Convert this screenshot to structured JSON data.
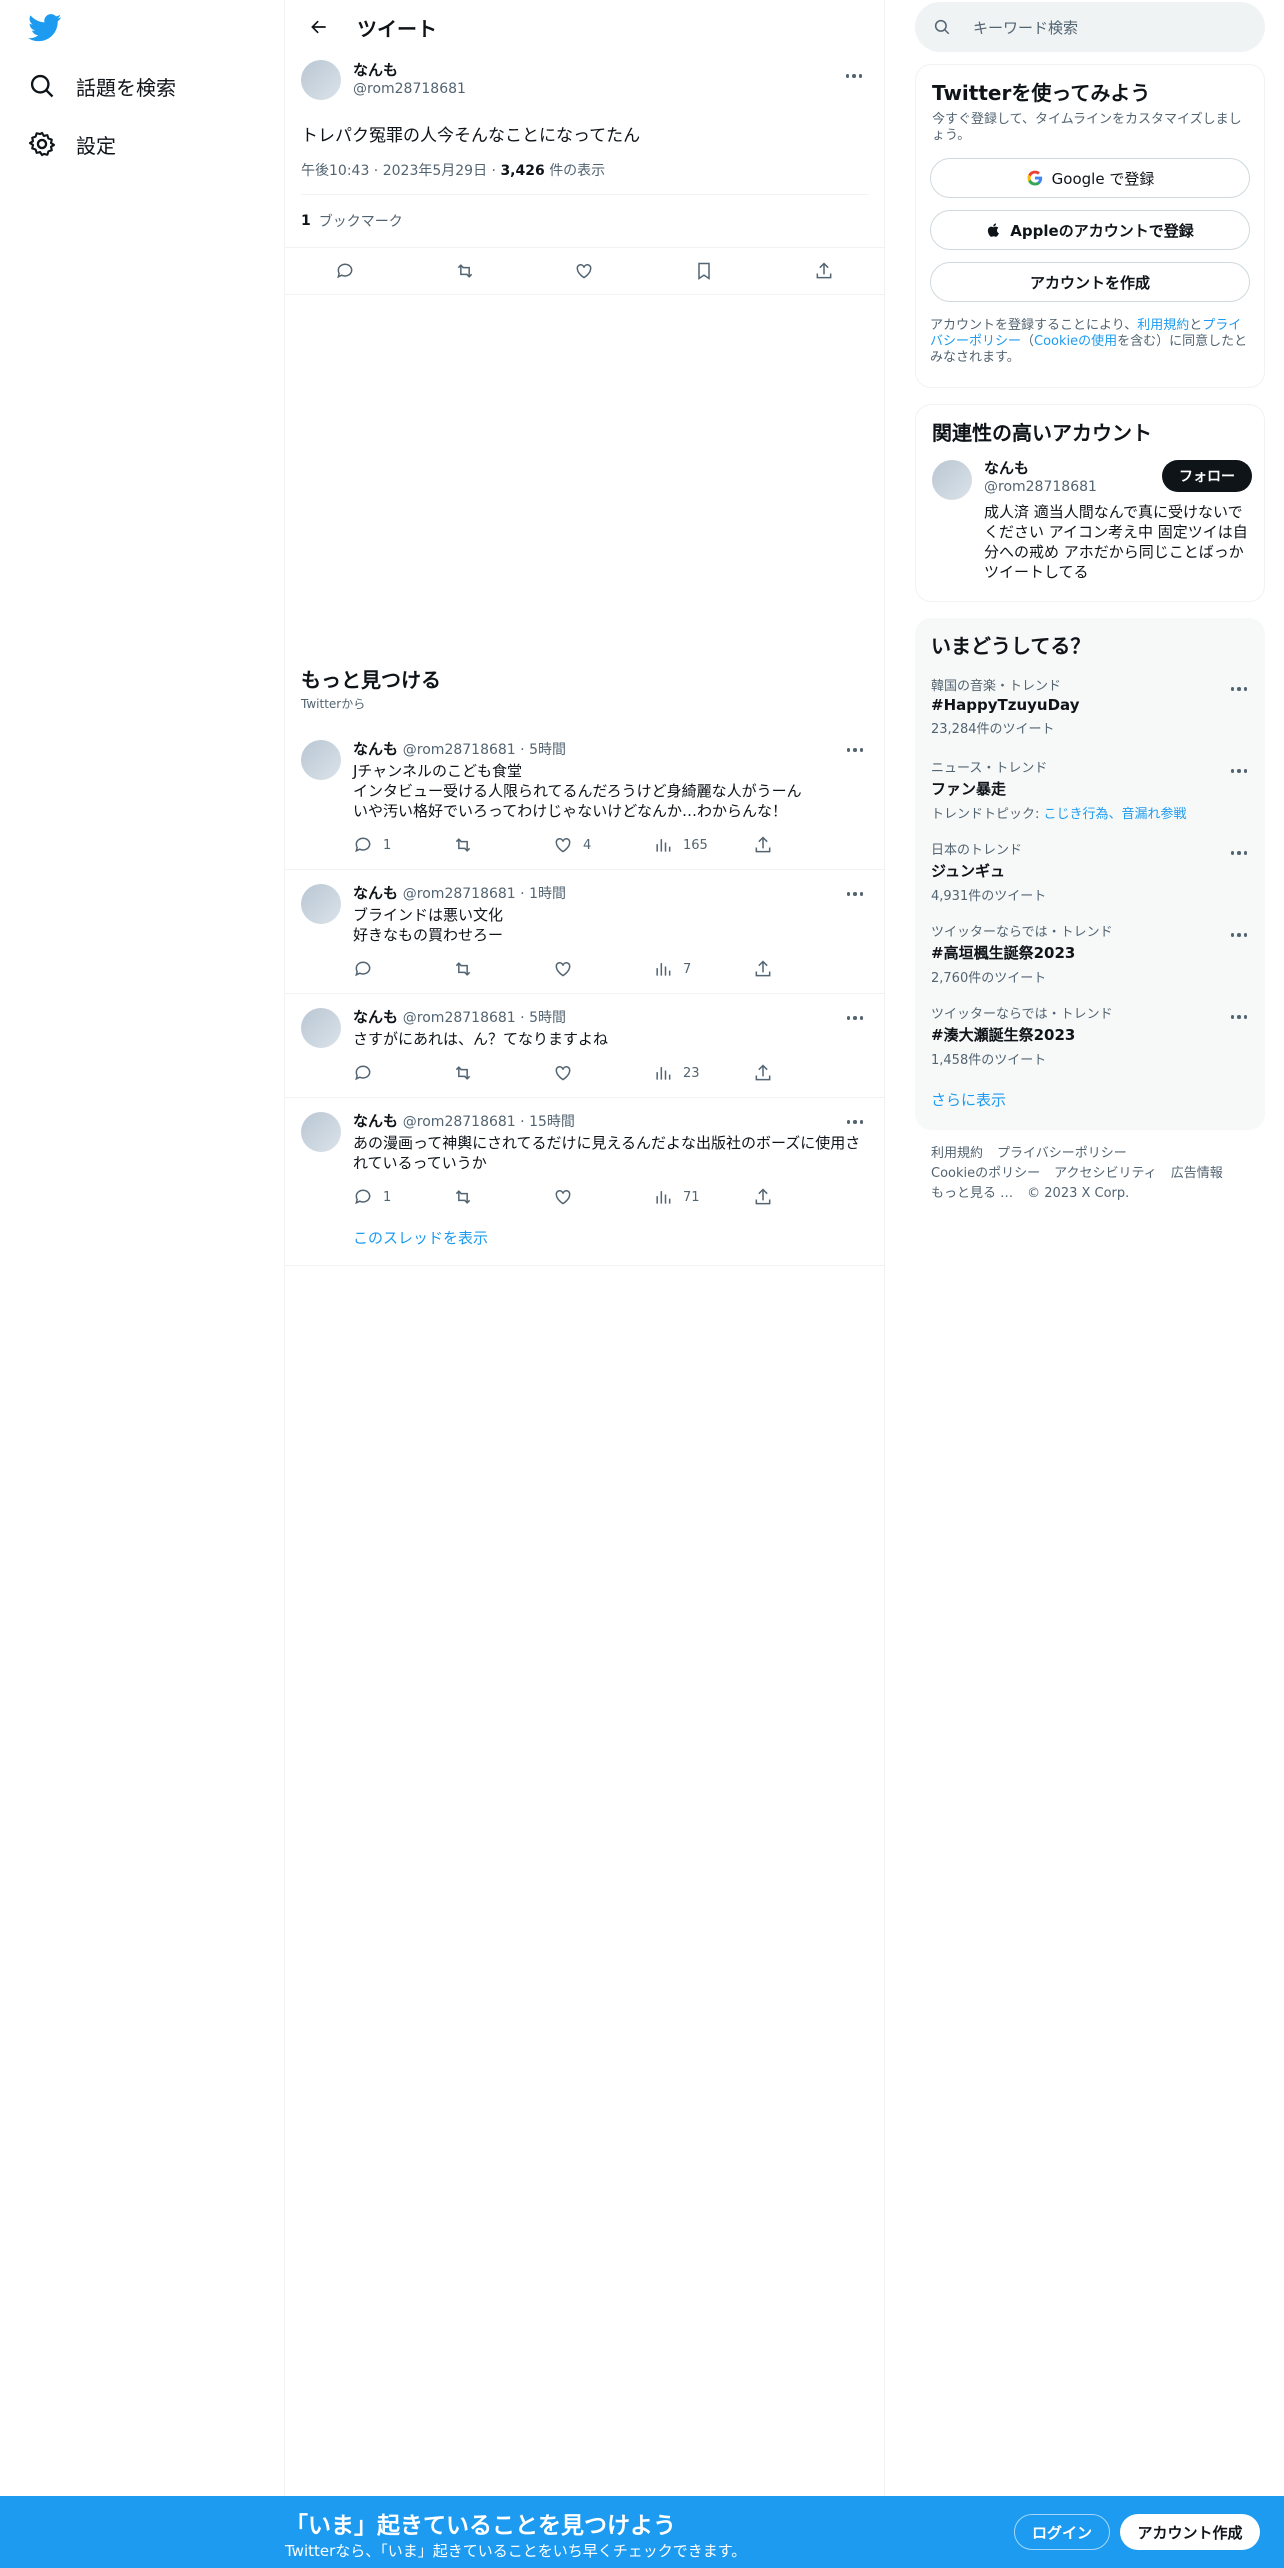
{
  "nav": {
    "search_label": "話題を検索",
    "settings_label": "設定"
  },
  "header": {
    "title": "ツイート"
  },
  "tweet": {
    "name": "なんも",
    "handle": "@rom28718681",
    "text": "トレパク冤罪の人今そんなことになってたん",
    "time": "午後10:43",
    "date": "2023年5月29日",
    "views": "3,426",
    "views_suffix": "件の表示",
    "bookmark_count": "1",
    "bookmark_label": "ブックマーク"
  },
  "discover": {
    "title": "もっと見つける",
    "subtitle": "Twitterから"
  },
  "replies": [
    {
      "name": "なんも",
      "handle": "@rom28718681",
      "time": "5時間",
      "line1": "Jチャンネルのこども食堂",
      "line2": "インタビュー受ける人限られてるんだろうけど身綺麗な人がうーん",
      "line3": "いや汚い格好でいろってわけじゃないけどなんか…わからんな！",
      "replies": "1",
      "retweets": "",
      "likes": "4",
      "views": "165"
    },
    {
      "name": "なんも",
      "handle": "@rom28718681",
      "time": "1時間",
      "line1": "ブラインドは悪い文化",
      "line2": "好きなもの買わせろー",
      "replies": "",
      "retweets": "",
      "likes": "",
      "views": "7"
    },
    {
      "name": "なんも",
      "handle": "@rom28718681",
      "time": "5時間",
      "line1": "さすがにあれは、ん？てなりますよね",
      "replies": "",
      "retweets": "",
      "likes": "",
      "views": "23"
    },
    {
      "name": "なんも",
      "handle": "@rom28718681",
      "time": "15時間",
      "line1": "あの漫画って神輿にされてるだけに見えるんだよな出版社のボーズに使用さ",
      "line2": "れているっていうか",
      "replies": "1",
      "retweets": "",
      "likes": "",
      "views": "71"
    }
  ],
  "show_thread": "このスレッドを表示",
  "search": {
    "placeholder": "キーワード検索"
  },
  "signup_card": {
    "title": "Twitterを使ってみよう",
    "subtitle": "今すぐ登録して、タイムラインをカスタマイズしましょう。",
    "google": "Google で登録",
    "apple": "Appleのアカウントで登録",
    "create": "アカウントを作成",
    "legal_1": "アカウントを登録することにより、",
    "legal_terms": "利用規約",
    "legal_2": "と",
    "legal_privacy": "プライバシーポリシー",
    "legal_3": "（",
    "legal_cookie": "Cookieの使用",
    "legal_4": "を含む）に同意したとみなされます。"
  },
  "related": {
    "title": "関連性の高いアカウント",
    "name": "なんも",
    "handle": "@rom28718681",
    "follow": "フォロー",
    "bio": "成人済 適当人間なんで真に受けないでください アイコン考え中 固定ツイは自分への戒め アホだから同じことばっかツイートしてる"
  },
  "trends": {
    "title": "いまどうしてる？",
    "items": [
      {
        "category": "韓国の音楽・トレンド",
        "name": "#HappyTzuyuDay",
        "count": "23,284件のツイート"
      },
      {
        "category": "ニュース・トレンド",
        "name": "ファン暴走",
        "topic_label": "トレンドトピック: ",
        "topic": "こじき行為、音漏れ参戦"
      },
      {
        "category": "日本のトレンド",
        "name": "ジュンギュ",
        "count": "4,931件のツイート"
      },
      {
        "category": "ツイッターならでは・トレンド",
        "name": "#高垣楓生誕祭2023",
        "count": "2,760件のツイート"
      },
      {
        "category": "ツイッターならでは・トレンド",
        "name": "#湊大瀬誕生祭2023",
        "count": "1,458件のツイート"
      }
    ],
    "show_more": "さらに表示"
  },
  "footer": {
    "terms": "利用規約",
    "privacy": "プライバシーポリシー",
    "cookie": "Cookieのポリシー",
    "accessibility": "アクセシビリティ",
    "ads": "広告情報",
    "more": "もっと見る …",
    "copyright": "© 2023 X Corp."
  },
  "bottom": {
    "title": "「いま」起きていることを見つけよう",
    "subtitle": "Twitterなら、「いま」起きていることをいち早くチェックできます。",
    "login": "ログイン",
    "signup": "アカウント作成"
  },
  "colors": {
    "brand": "#1d9bf0",
    "text": "#0f1419",
    "secondary": "#536471"
  }
}
